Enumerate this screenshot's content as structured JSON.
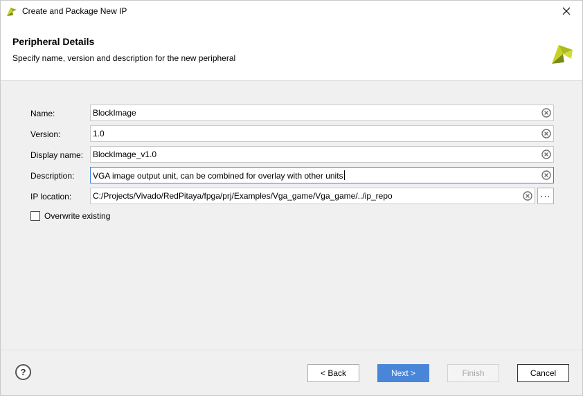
{
  "window": {
    "title": "Create and Package New IP"
  },
  "header": {
    "title": "Peripheral Details",
    "subtitle": "Specify name, version and description for the new peripheral"
  },
  "form": {
    "name": {
      "label": "Name:",
      "value": "BlockImage"
    },
    "version": {
      "label": "Version:",
      "value": "1.0"
    },
    "display_name": {
      "label": "Display name:",
      "value": "BlockImage_v1.0"
    },
    "description": {
      "label": "Description:",
      "value": "VGA image output unit, can be combined for overlay with other units"
    },
    "ip_location": {
      "label": "IP location:",
      "value": "C:/Projects/Vivado/RedPitaya/fpga/prj/Examples/Vga_game/Vga_game/../ip_repo",
      "browse_label": "···"
    },
    "overwrite": {
      "label": "Overwrite existing",
      "checked": false
    }
  },
  "footer": {
    "help_label": "?",
    "back_label": "< Back",
    "next_label": "Next >",
    "finish_label": "Finish",
    "cancel_label": "Cancel"
  },
  "colors": {
    "accent": "#4a86d8",
    "focus_border": "#3c7fd6",
    "logo_yellow": "#c8d21e",
    "logo_olive": "#7a8a1a"
  },
  "icons": {
    "title_logo": "vivado-logo-icon",
    "header_logo": "vivado-logo-icon",
    "close": "close-icon",
    "clear": "clear-circle-x-icon",
    "help": "help-circle-icon"
  }
}
